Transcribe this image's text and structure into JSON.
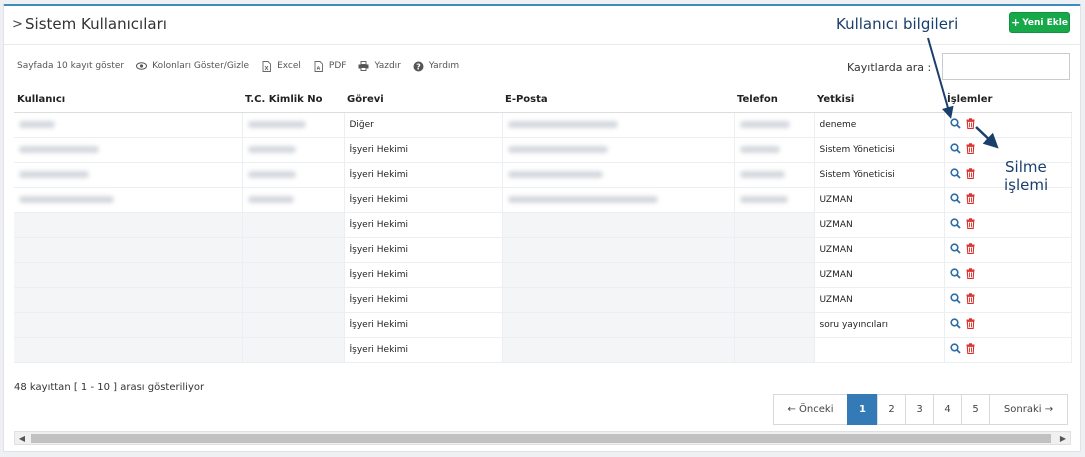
{
  "panel": {
    "title": "Sistem Kullanıcıları",
    "new_button": "Yeni Ekle"
  },
  "toolbar": {
    "page_size": "Sayfada 10 kayıt göster",
    "columns": "Kolonları Göster/Gizle",
    "excel": "Excel",
    "pdf": "PDF",
    "print": "Yazdır",
    "help": "Yardım"
  },
  "search": {
    "label": "Kayıtlarda ara :",
    "value": ""
  },
  "table": {
    "headers": [
      "Kullanıcı",
      "T.C. Kimlik No",
      "Görevi",
      "E-Posta",
      "Telefon",
      "Yetkisi",
      "İşlemler"
    ],
    "rows": [
      {
        "gorevi": "Diğer",
        "yetkisi": "deneme"
      },
      {
        "gorevi": "İşyeri Hekimi",
        "yetkisi": "Sistem Yöneticisi"
      },
      {
        "gorevi": "İşyeri Hekimi",
        "yetkisi": "Sistem Yöneticisi"
      },
      {
        "gorevi": "İşyeri Hekimi",
        "yetkisi": "UZMAN"
      },
      {
        "gorevi": "İşyeri Hekimi",
        "yetkisi": "UZMAN"
      },
      {
        "gorevi": "İşyeri Hekimi",
        "yetkisi": "UZMAN"
      },
      {
        "gorevi": "İşyeri Hekimi",
        "yetkisi": "UZMAN"
      },
      {
        "gorevi": "İşyeri Hekimi",
        "yetkisi": "UZMAN"
      },
      {
        "gorevi": "İşyeri Hekimi",
        "yetkisi": "soru yayıncıları"
      },
      {
        "gorevi": "İşyeri Hekimi",
        "yetkisi": ""
      }
    ]
  },
  "info": "48 kayıttan [ 1 - 10 ] arası gösteriliyor",
  "pagination": {
    "prev": "← Önceki",
    "pages": [
      "1",
      "2",
      "3",
      "4",
      "5"
    ],
    "active": "1",
    "next": "Sonraki →"
  },
  "annotations": {
    "user_info": "Kullanıcı bilgileri",
    "delete_1": "Silme",
    "delete_2": "işlemi"
  },
  "colors": {
    "accent": "#337ab7",
    "add_button": "#17a84a",
    "search_icon": "#2e6da4",
    "delete_icon": "#d9302c",
    "annotation": "#1a3f6b"
  },
  "icons": {
    "header_chevron": "chevron-right-icon",
    "new_button": "plus-icon",
    "columns": "eye-icon",
    "excel": "file-excel-icon",
    "pdf": "file-pdf-icon",
    "print": "print-icon",
    "help": "question-circle-icon",
    "row_view": "search-icon",
    "row_delete": "trash-icon"
  }
}
